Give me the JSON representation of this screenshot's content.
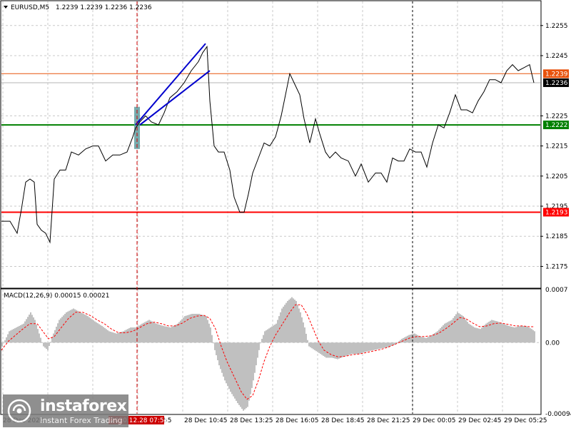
{
  "header": {
    "symbol": "EURUSD,M5",
    "ohlc": "1.2239 1.2239 1.2236 1.2236"
  },
  "macd": {
    "label": "MACD(12,26,9) 0.00015 0.00021"
  },
  "watermark": {
    "name": "instaforex",
    "tagline": "Instant Forex Trading"
  },
  "colors": {
    "background": "#ffffff",
    "grid": "#c8c8c8",
    "price": "#000000",
    "resistance": "#e8520c",
    "support_green": "#008000",
    "support_red": "#ff0000",
    "trend": "#0000cd",
    "histogram": "#c0c0c0",
    "signal": "#ff0000",
    "vline": "#d00000",
    "session_line": "#000000",
    "highlight": "#5f9ea0"
  },
  "chart_data": [
    {
      "type": "line",
      "symbol": "EURUSD",
      "timeframe": "M5",
      "ylim": [
        1.2168,
        1.2263
      ],
      "yticks": [
        "1.2255",
        "1.2245",
        "1.2225",
        "1.2215",
        "1.2205",
        "1.2195",
        "1.2185",
        "1.2175"
      ],
      "xticks": [
        "28 Dec 2020",
        "28 Dec 07:55",
        "28 Dec 10:45",
        "28 Dec 13:25",
        "28 Dec 16:05",
        "28 Dec 18:45",
        "28 Dec 21:25",
        "29 Dec 00:05",
        "29 Dec 02:45",
        "29 Dec 05:25"
      ],
      "highlighted_xtick": "2020.12.28 07:55",
      "levels": [
        {
          "label": "1.2239",
          "value": 1.2239,
          "color": "#e8520c"
        },
        {
          "label": "1.2236",
          "value": 1.2236,
          "color": "#000000"
        },
        {
          "label": "1.2222",
          "value": 1.2222,
          "color": "#008000"
        },
        {
          "label": "1.2193",
          "value": 1.2193,
          "color": "#ff0000"
        }
      ],
      "trend_lines": [
        {
          "from": [
            190,
            1.2222
          ],
          "to": [
            288,
            1.2249
          ]
        },
        {
          "from": [
            196,
            1.2222
          ],
          "to": [
            294,
            1.224
          ]
        }
      ],
      "series": [
        {
          "points": [
            [
              0,
              1.219
            ],
            [
              12,
              1.219
            ],
            [
              22,
              1.2186
            ],
            [
              28,
              1.2194
            ],
            [
              34,
              1.2203
            ],
            [
              40,
              1.2204
            ],
            [
              46,
              1.2203
            ],
            [
              50,
              1.2189
            ],
            [
              56,
              1.2187
            ],
            [
              62,
              1.2186
            ],
            [
              68,
              1.2183
            ],
            [
              74,
              1.2204
            ],
            [
              82,
              1.2207
            ],
            [
              90,
              1.2207
            ],
            [
              98,
              1.2213
            ],
            [
              108,
              1.2212
            ],
            [
              118,
              1.2214
            ],
            [
              128,
              1.2215
            ],
            [
              136,
              1.2215
            ],
            [
              146,
              1.221
            ],
            [
              156,
              1.2212
            ],
            [
              166,
              1.2212
            ],
            [
              176,
              1.2213
            ],
            [
              184,
              1.2218
            ],
            [
              188,
              1.2221
            ],
            [
              194,
              1.2223
            ],
            [
              202,
              1.2225
            ],
            [
              210,
              1.2223
            ],
            [
              220,
              1.2222
            ],
            [
              228,
              1.2226
            ],
            [
              236,
              1.2231
            ],
            [
              246,
              1.2233
            ],
            [
              256,
              1.2236
            ],
            [
              266,
              1.224
            ],
            [
              276,
              1.2243
            ],
            [
              282,
              1.2246
            ],
            [
              288,
              1.2248
            ],
            [
              292,
              1.223
            ],
            [
              298,
              1.2215
            ],
            [
              304,
              1.2213
            ],
            [
              312,
              1.2213
            ],
            [
              320,
              1.2207
            ],
            [
              326,
              1.2198
            ],
            [
              334,
              1.2193
            ],
            [
              340,
              1.2193
            ],
            [
              346,
              1.2199
            ],
            [
              352,
              1.2206
            ],
            [
              360,
              1.2211
            ],
            [
              368,
              1.2216
            ],
            [
              376,
              1.2215
            ],
            [
              384,
              1.2218
            ],
            [
              392,
              1.2225
            ],
            [
              398,
              1.2232
            ],
            [
              404,
              1.2239
            ],
            [
              410,
              1.2236
            ],
            [
              418,
              1.2232
            ],
            [
              424,
              1.2224
            ],
            [
              432,
              1.2216
            ],
            [
              440,
              1.2224
            ],
            [
              446,
              1.2219
            ],
            [
              454,
              1.2213
            ],
            [
              460,
              1.2211
            ],
            [
              468,
              1.2213
            ],
            [
              476,
              1.2211
            ],
            [
              486,
              1.221
            ],
            [
              496,
              1.2205
            ],
            [
              504,
              1.2209
            ],
            [
              514,
              1.2203
            ],
            [
              524,
              1.2206
            ],
            [
              532,
              1.2206
            ],
            [
              540,
              1.2203
            ],
            [
              548,
              1.2211
            ],
            [
              556,
              1.221
            ],
            [
              564,
              1.221
            ],
            [
              572,
              1.2214
            ],
            [
              580,
              1.2213
            ],
            [
              588,
              1.2213
            ],
            [
              596,
              1.2208
            ],
            [
              604,
              1.2216
            ],
            [
              612,
              1.2222
            ],
            [
              620,
              1.2221
            ],
            [
              628,
              1.2226
            ],
            [
              636,
              1.2232
            ],
            [
              644,
              1.2227
            ],
            [
              652,
              1.2227
            ],
            [
              660,
              1.2226
            ],
            [
              668,
              1.223
            ],
            [
              676,
              1.2233
            ],
            [
              684,
              1.2237
            ],
            [
              692,
              1.2237
            ],
            [
              700,
              1.2236
            ],
            [
              708,
              1.224
            ],
            [
              716,
              1.2242
            ],
            [
              724,
              1.224
            ],
            [
              732,
              1.2241
            ],
            [
              740,
              1.2242
            ],
            [
              746,
              1.2236
            ]
          ]
        }
      ]
    },
    {
      "type": "bar",
      "indicator": "MACD",
      "params": [
        12,
        26,
        9
      ],
      "value": 0.00015,
      "signal_value": 0.00021,
      "ylim": [
        -0.00094,
        0.0007
      ],
      "yticks": [
        "0.0007",
        "0.00",
        "-0.00094"
      ],
      "histogram": [
        [
          0,
          -5e-05
        ],
        [
          10,
          0.00015
        ],
        [
          20,
          0.0002
        ],
        [
          30,
          0.00025
        ],
        [
          40,
          0.0004
        ],
        [
          46,
          0.0003
        ],
        [
          52,
          0.00012
        ],
        [
          58,
          -5e-05
        ],
        [
          64,
          -0.0001
        ],
        [
          72,
          0.00012
        ],
        [
          80,
          0.0003
        ],
        [
          90,
          0.0004
        ],
        [
          100,
          0.00045
        ],
        [
          110,
          0.0004
        ],
        [
          120,
          0.00035
        ],
        [
          130,
          0.00028
        ],
        [
          140,
          0.00022
        ],
        [
          150,
          0.00015
        ],
        [
          160,
          0.00012
        ],
        [
          170,
          0.00015
        ],
        [
          180,
          0.0002
        ],
        [
          188,
          0.0002
        ],
        [
          196,
          0.00025
        ],
        [
          206,
          0.0003
        ],
        [
          216,
          0.00025
        ],
        [
          226,
          0.00022
        ],
        [
          236,
          0.0002
        ],
        [
          246,
          0.00025
        ],
        [
          256,
          0.00035
        ],
        [
          266,
          0.00038
        ],
        [
          276,
          0.00038
        ],
        [
          286,
          0.00035
        ],
        [
          292,
          0.0002
        ],
        [
          298,
          -0.0001
        ],
        [
          304,
          -0.0003
        ],
        [
          312,
          -0.0005
        ],
        [
          320,
          -0.00065
        ],
        [
          330,
          -0.0008
        ],
        [
          338,
          -0.0009
        ],
        [
          344,
          -0.00085
        ],
        [
          350,
          -0.0006
        ],
        [
          356,
          -0.0003
        ],
        [
          362,
          0.0
        ],
        [
          368,
          0.00015
        ],
        [
          376,
          0.0002
        ],
        [
          384,
          0.00025
        ],
        [
          392,
          0.00045
        ],
        [
          400,
          0.00055
        ],
        [
          406,
          0.0006
        ],
        [
          412,
          0.00055
        ],
        [
          418,
          0.0004
        ],
        [
          424,
          0.0002
        ],
        [
          430,
          -5e-05
        ],
        [
          438,
          -0.0001
        ],
        [
          446,
          -0.00015
        ],
        [
          454,
          -0.0002
        ],
        [
          462,
          -0.0002
        ],
        [
          470,
          -0.00022
        ],
        [
          480,
          -0.00018
        ],
        [
          490,
          -0.00015
        ],
        [
          500,
          -0.00015
        ],
        [
          510,
          -0.00012
        ],
        [
          520,
          -0.0001
        ],
        [
          530,
          -8e-05
        ],
        [
          540,
          -6e-05
        ],
        [
          550,
          -3e-05
        ],
        [
          560,
          5e-05
        ],
        [
          570,
          0.0001
        ],
        [
          578,
          0.00012
        ],
        [
          586,
          8e-05
        ],
        [
          594,
          6e-05
        ],
        [
          602,
          0.0001
        ],
        [
          610,
          0.00015
        ],
        [
          620,
          0.00025
        ],
        [
          630,
          0.0003
        ],
        [
          638,
          0.0004
        ],
        [
          646,
          0.00035
        ],
        [
          654,
          0.00025
        ],
        [
          662,
          0.0002
        ],
        [
          670,
          0.00018
        ],
        [
          678,
          0.00025
        ],
        [
          686,
          0.0003
        ],
        [
          694,
          0.00028
        ],
        [
          702,
          0.00025
        ],
        [
          710,
          0.00022
        ],
        [
          718,
          0.0002
        ],
        [
          726,
          0.00022
        ],
        [
          734,
          0.00022
        ],
        [
          742,
          0.00018
        ],
        [
          746,
          0.00015
        ]
      ],
      "signal": [
        [
          0,
          -0.0001
        ],
        [
          10,
          2e-05
        ],
        [
          20,
          0.0001
        ],
        [
          30,
          0.00018
        ],
        [
          40,
          0.00025
        ],
        [
          50,
          0.00025
        ],
        [
          58,
          0.00015
        ],
        [
          66,
          5e-05
        ],
        [
          74,
          8e-05
        ],
        [
          84,
          0.0002
        ],
        [
          94,
          0.00032
        ],
        [
          104,
          0.0004
        ],
        [
          114,
          0.0004
        ],
        [
          124,
          0.00036
        ],
        [
          134,
          0.0003
        ],
        [
          144,
          0.00025
        ],
        [
          154,
          0.00018
        ],
        [
          164,
          0.00013
        ],
        [
          174,
          0.00013
        ],
        [
          184,
          0.00015
        ],
        [
          194,
          0.0002
        ],
        [
          204,
          0.00025
        ],
        [
          214,
          0.00027
        ],
        [
          224,
          0.00025
        ],
        [
          234,
          0.00022
        ],
        [
          244,
          0.00022
        ],
        [
          254,
          0.00026
        ],
        [
          264,
          0.00032
        ],
        [
          274,
          0.00035
        ],
        [
          284,
          0.00036
        ],
        [
          292,
          0.00032
        ],
        [
          300,
          0.00018
        ],
        [
          308,
          -5e-05
        ],
        [
          316,
          -0.00025
        ],
        [
          326,
          -0.00045
        ],
        [
          336,
          -0.00065
        ],
        [
          344,
          -0.00075
        ],
        [
          352,
          -0.0007
        ],
        [
          360,
          -0.0005
        ],
        [
          368,
          -0.00025
        ],
        [
          376,
          -5e-05
        ],
        [
          384,
          0.0001
        ],
        [
          394,
          0.00025
        ],
        [
          404,
          0.0004
        ],
        [
          412,
          0.0005
        ],
        [
          420,
          0.0005
        ],
        [
          428,
          0.00038
        ],
        [
          436,
          0.0002
        ],
        [
          444,
          2e-05
        ],
        [
          452,
          -0.0001
        ],
        [
          462,
          -0.00016
        ],
        [
          472,
          -0.00019
        ],
        [
          482,
          -0.00018
        ],
        [
          492,
          -0.00016
        ],
        [
          502,
          -0.00015
        ],
        [
          512,
          -0.00013
        ],
        [
          522,
          -0.00011
        ],
        [
          532,
          -9e-05
        ],
        [
          542,
          -6e-05
        ],
        [
          552,
          -2e-05
        ],
        [
          562,
          2e-05
        ],
        [
          572,
          6e-05
        ],
        [
          582,
          8e-05
        ],
        [
          592,
          8e-05
        ],
        [
          602,
          9e-05
        ],
        [
          612,
          0.00012
        ],
        [
          622,
          0.00018
        ],
        [
          632,
          0.00025
        ],
        [
          642,
          0.00033
        ],
        [
          650,
          0.00032
        ],
        [
          660,
          0.00026
        ],
        [
          670,
          0.00021
        ],
        [
          680,
          0.00022
        ],
        [
          690,
          0.00025
        ],
        [
          700,
          0.00026
        ],
        [
          710,
          0.00024
        ],
        [
          720,
          0.00022
        ],
        [
          730,
          0.00022
        ],
        [
          740,
          0.00021
        ],
        [
          746,
          0.00021
        ]
      ]
    }
  ]
}
